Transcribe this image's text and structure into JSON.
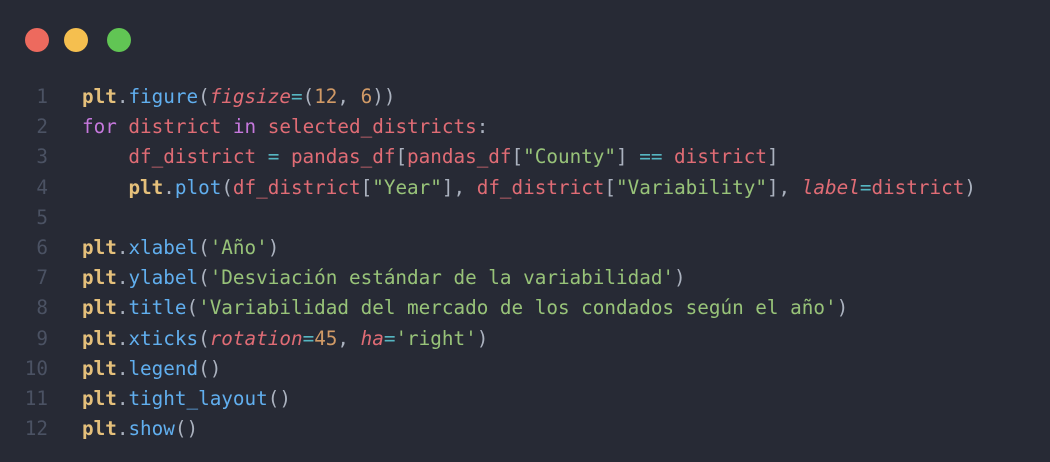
{
  "window": {
    "controls": [
      {
        "name": "close",
        "color": "#ed6a5e"
      },
      {
        "name": "minimize",
        "color": "#f5bf4f"
      },
      {
        "name": "maximize",
        "color": "#61c554"
      }
    ]
  },
  "colors": {
    "background": "#272a35",
    "line_number": "#4b5263",
    "object": "#e5c07b",
    "function": "#61afef",
    "keyword": "#c678dd",
    "variable": "#e06c75",
    "string": "#98c379",
    "number": "#d19a66",
    "operator": "#56b6c2",
    "punctuation": "#abb2bf"
  },
  "code": {
    "lines": [
      {
        "number": "1",
        "tokens": [
          {
            "t": "plt",
            "c": "obj"
          },
          {
            "t": ".",
            "c": "plain"
          },
          {
            "t": "figure",
            "c": "fn"
          },
          {
            "t": "(",
            "c": "plain"
          },
          {
            "t": "figsize",
            "c": "kwarg"
          },
          {
            "t": "=",
            "c": "op"
          },
          {
            "t": "(",
            "c": "plain"
          },
          {
            "t": "12",
            "c": "num"
          },
          {
            "t": ", ",
            "c": "plain"
          },
          {
            "t": "6",
            "c": "num"
          },
          {
            "t": "))",
            "c": "plain"
          }
        ]
      },
      {
        "number": "2",
        "tokens": [
          {
            "t": "for",
            "c": "kw"
          },
          {
            "t": " district ",
            "c": "var"
          },
          {
            "t": "in",
            "c": "kw"
          },
          {
            "t": " selected_districts",
            "c": "var"
          },
          {
            "t": ":",
            "c": "plain"
          }
        ]
      },
      {
        "number": "3",
        "tokens": [
          {
            "t": "    df_district ",
            "c": "var"
          },
          {
            "t": "=",
            "c": "op"
          },
          {
            "t": " pandas_df",
            "c": "var"
          },
          {
            "t": "[",
            "c": "plain"
          },
          {
            "t": "pandas_df",
            "c": "var"
          },
          {
            "t": "[",
            "c": "plain"
          },
          {
            "t": "\"County\"",
            "c": "str"
          },
          {
            "t": "] ",
            "c": "plain"
          },
          {
            "t": "==",
            "c": "op"
          },
          {
            "t": " district",
            "c": "var"
          },
          {
            "t": "]",
            "c": "plain"
          }
        ]
      },
      {
        "number": "4",
        "tokens": [
          {
            "t": "    ",
            "c": "plain"
          },
          {
            "t": "plt",
            "c": "obj"
          },
          {
            "t": ".",
            "c": "plain"
          },
          {
            "t": "plot",
            "c": "fn"
          },
          {
            "t": "(",
            "c": "plain"
          },
          {
            "t": "df_district",
            "c": "var"
          },
          {
            "t": "[",
            "c": "plain"
          },
          {
            "t": "\"Year\"",
            "c": "str"
          },
          {
            "t": "], ",
            "c": "plain"
          },
          {
            "t": "df_district",
            "c": "var"
          },
          {
            "t": "[",
            "c": "plain"
          },
          {
            "t": "\"Variability\"",
            "c": "str"
          },
          {
            "t": "], ",
            "c": "plain"
          },
          {
            "t": "label",
            "c": "kwarg"
          },
          {
            "t": "=",
            "c": "op"
          },
          {
            "t": "district",
            "c": "var"
          },
          {
            "t": ")",
            "c": "plain"
          }
        ]
      },
      {
        "number": "5",
        "tokens": []
      },
      {
        "number": "6",
        "tokens": [
          {
            "t": "plt",
            "c": "obj"
          },
          {
            "t": ".",
            "c": "plain"
          },
          {
            "t": "xlabel",
            "c": "fn"
          },
          {
            "t": "(",
            "c": "plain"
          },
          {
            "t": "'Año'",
            "c": "str"
          },
          {
            "t": ")",
            "c": "plain"
          }
        ]
      },
      {
        "number": "7",
        "tokens": [
          {
            "t": "plt",
            "c": "obj"
          },
          {
            "t": ".",
            "c": "plain"
          },
          {
            "t": "ylabel",
            "c": "fn"
          },
          {
            "t": "(",
            "c": "plain"
          },
          {
            "t": "'Desviación estándar de la variabilidad'",
            "c": "str"
          },
          {
            "t": ")",
            "c": "plain"
          }
        ]
      },
      {
        "number": "8",
        "tokens": [
          {
            "t": "plt",
            "c": "obj"
          },
          {
            "t": ".",
            "c": "plain"
          },
          {
            "t": "title",
            "c": "fn"
          },
          {
            "t": "(",
            "c": "plain"
          },
          {
            "t": "'Variabilidad del mercado de los condados según el año'",
            "c": "str"
          },
          {
            "t": ")",
            "c": "plain"
          }
        ]
      },
      {
        "number": "9",
        "tokens": [
          {
            "t": "plt",
            "c": "obj"
          },
          {
            "t": ".",
            "c": "plain"
          },
          {
            "t": "xticks",
            "c": "fn"
          },
          {
            "t": "(",
            "c": "plain"
          },
          {
            "t": "rotation",
            "c": "kwarg"
          },
          {
            "t": "=",
            "c": "op"
          },
          {
            "t": "45",
            "c": "num"
          },
          {
            "t": ", ",
            "c": "plain"
          },
          {
            "t": "ha",
            "c": "kwarg"
          },
          {
            "t": "=",
            "c": "op"
          },
          {
            "t": "'right'",
            "c": "str"
          },
          {
            "t": ")",
            "c": "plain"
          }
        ]
      },
      {
        "number": "10",
        "tokens": [
          {
            "t": "plt",
            "c": "obj"
          },
          {
            "t": ".",
            "c": "plain"
          },
          {
            "t": "legend",
            "c": "fn"
          },
          {
            "t": "()",
            "c": "plain"
          }
        ]
      },
      {
        "number": "11",
        "tokens": [
          {
            "t": "plt",
            "c": "obj"
          },
          {
            "t": ".",
            "c": "plain"
          },
          {
            "t": "tight_layout",
            "c": "fn"
          },
          {
            "t": "()",
            "c": "plain"
          }
        ]
      },
      {
        "number": "12",
        "tokens": [
          {
            "t": "plt",
            "c": "obj"
          },
          {
            "t": ".",
            "c": "plain"
          },
          {
            "t": "show",
            "c": "fn"
          },
          {
            "t": "()",
            "c": "plain"
          }
        ]
      }
    ]
  }
}
